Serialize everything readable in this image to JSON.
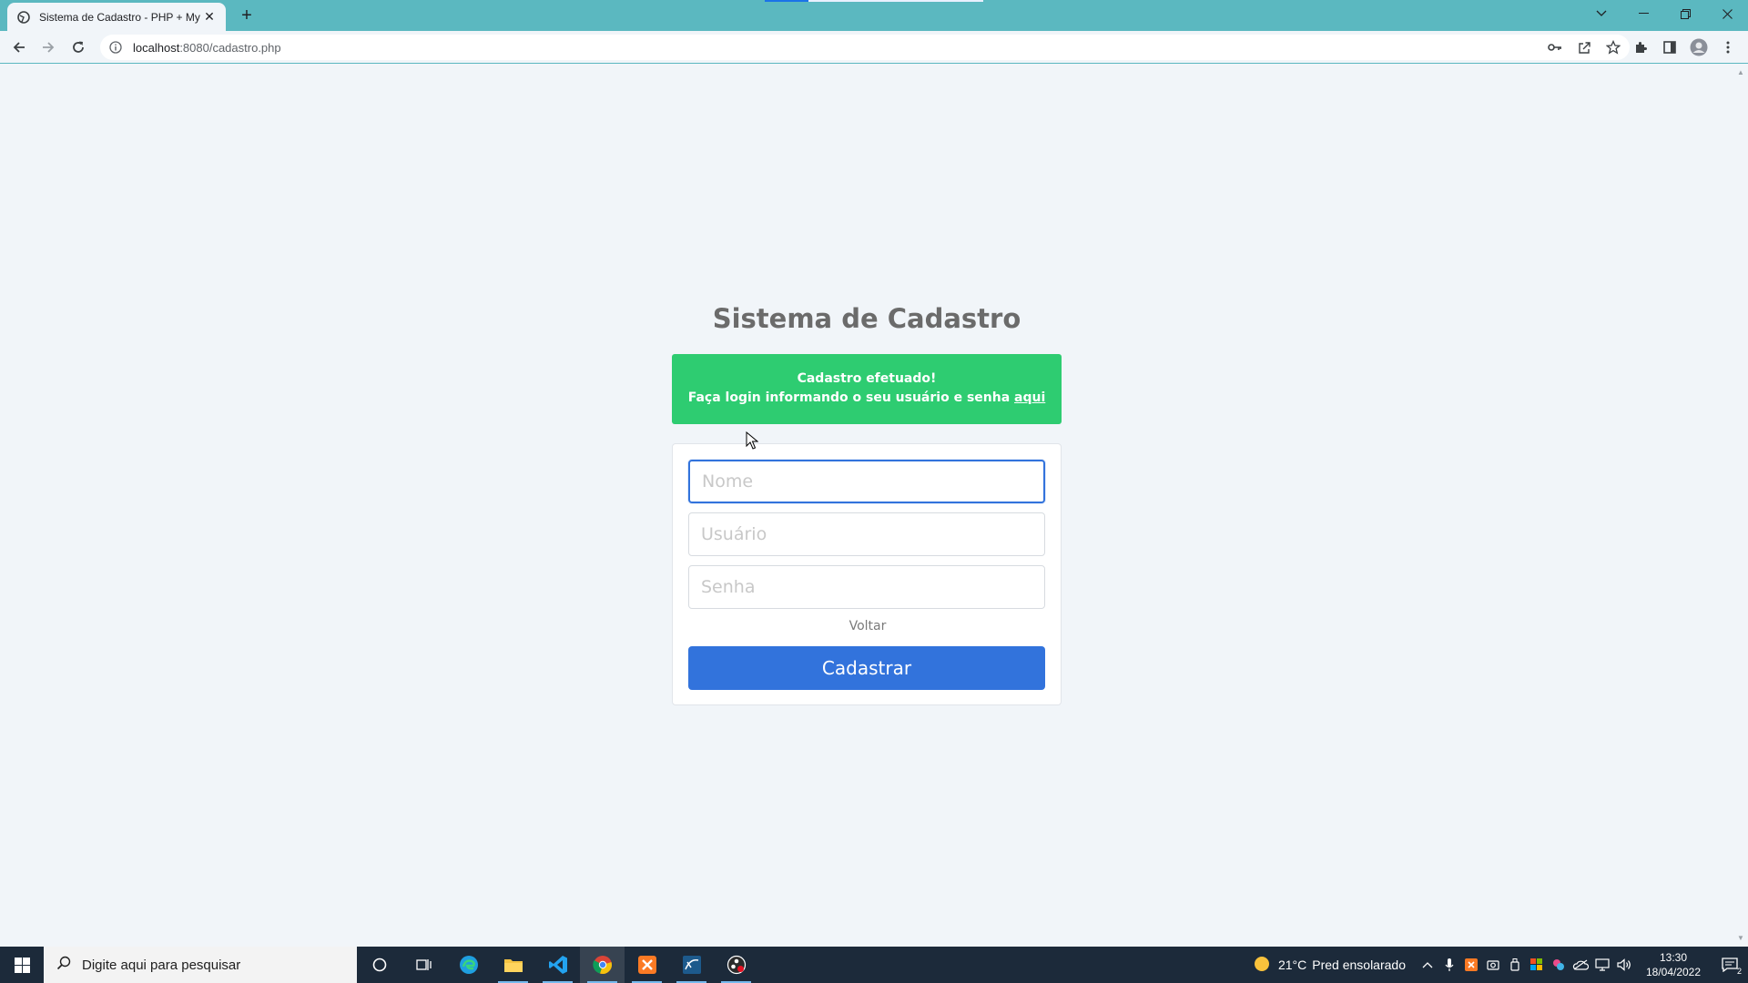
{
  "browser": {
    "tab_title": "Sistema de Cadastro - PHP + My",
    "url_host": "localhost",
    "url_path": ":8080/cadastro.php",
    "colors": {
      "tabstrip": "#5bb8c0",
      "toolbar": "#f1f5f9"
    }
  },
  "page": {
    "title": "Sistema de Cadastro",
    "alert": {
      "line1": "Cadastro efetuado!",
      "line2": "Faça login informando o seu usuário e senha",
      "link": "aqui",
      "color": "#2ecc71"
    },
    "form": {
      "nome_placeholder": "Nome",
      "usuario_placeholder": "Usuário",
      "senha_placeholder": "Senha",
      "voltar": "Voltar",
      "submit": "Cadastrar",
      "submit_color": "#3273dc"
    }
  },
  "taskbar": {
    "search_placeholder": "Digite aqui para pesquisar",
    "weather_temp": "21°C",
    "weather_desc": "Pred ensolarado",
    "time": "13:30",
    "date": "18/04/2022",
    "notification_count": "2"
  }
}
